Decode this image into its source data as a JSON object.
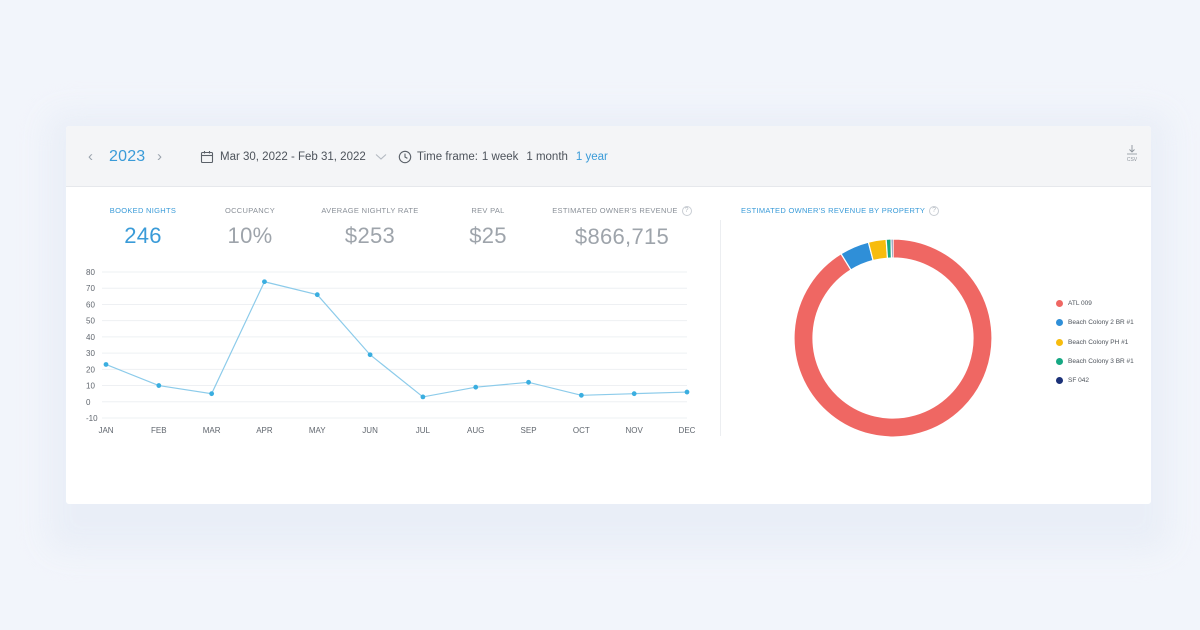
{
  "toolbar": {
    "year": "2023",
    "date_range": "Mar 30, 2022 - Feb 31, 2022",
    "time_frame_label": "Time frame:",
    "time_frame_options": [
      "1 week",
      "1 month",
      "1 year"
    ],
    "time_frame_active": "1 year",
    "csv_label": "CSV"
  },
  "metrics": [
    {
      "label": "BOOKED NIGHTS",
      "value": "246"
    },
    {
      "label": "OCCUPANCY",
      "value": "10%"
    },
    {
      "label": "AVERAGE NIGHTLY RATE",
      "value": "$253"
    },
    {
      "label": "REV PAL",
      "value": "$25"
    },
    {
      "label": "ESTIMATED OWNER'S REVENUE",
      "value": "$866,715"
    }
  ],
  "donut_title": "ESTIMATED OWNER'S REVENUE BY PROPERTY",
  "colors": {
    "accent": "#3a9bd8",
    "line": "#8ccbea",
    "point": "#3aaee0"
  },
  "chart_data": [
    {
      "type": "line",
      "categories": [
        "JAN",
        "FEB",
        "MAR",
        "APR",
        "MAY",
        "JUN",
        "JUL",
        "AUG",
        "SEP",
        "OCT",
        "NOV",
        "DEC"
      ],
      "series": [
        {
          "values": [
            23,
            10,
            5,
            74,
            66,
            29,
            3,
            9,
            12,
            4,
            5,
            6
          ]
        }
      ],
      "ylim": [
        -10,
        80
      ],
      "yticks": [
        80,
        70,
        60,
        50,
        40,
        30,
        20,
        10,
        0,
        -10
      ],
      "grid": true
    },
    {
      "type": "pie",
      "title": "ESTIMATED OWNER'S REVENUE BY PROPERTY",
      "categories": [
        "ATL 009",
        "Beach Colony 2 BR #1",
        "Beach Colony PH #1",
        "Beach Colony 3 BR #1",
        "SF 042"
      ],
      "values": [
        91.2,
        4.8,
        2.9,
        0.8,
        0.3
      ],
      "colors": [
        "#ef6763",
        "#2f8fd8",
        "#f7bc0e",
        "#16a883",
        "#1b3178"
      ],
      "legend": "right"
    }
  ]
}
